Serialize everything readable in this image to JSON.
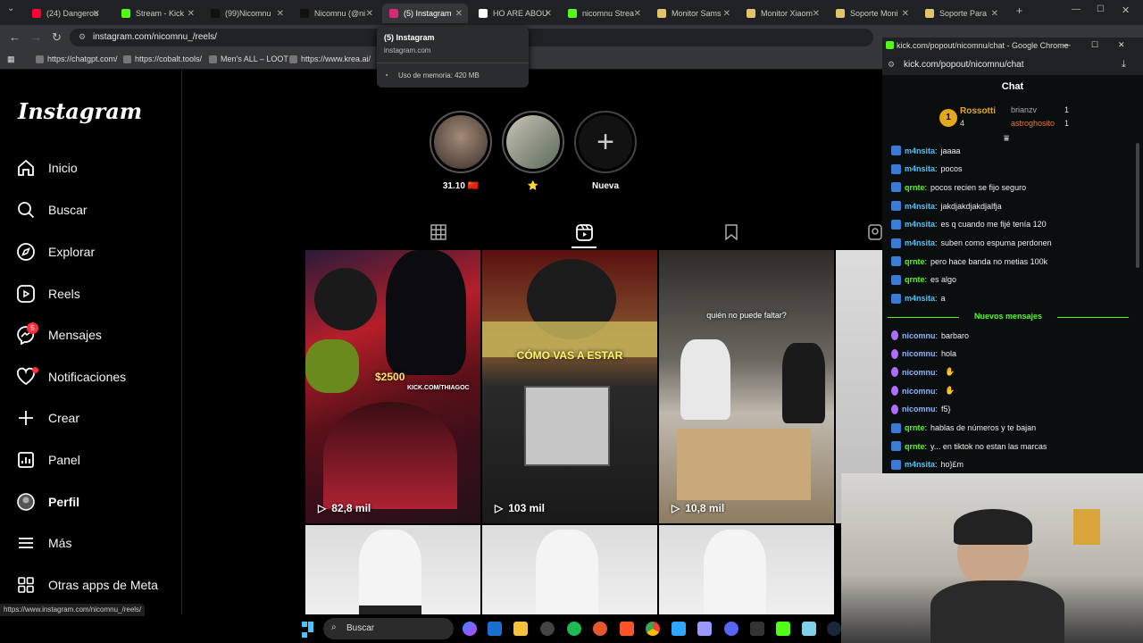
{
  "tabs": [
    {
      "label": "(24) Dangerou",
      "icon": "youtube-icon"
    },
    {
      "label": "Stream - Kick",
      "icon": "kick-icon"
    },
    {
      "label": "(99)Nicomnu",
      "icon": "tiktok-icon"
    },
    {
      "label": "Nicomnu (@ni",
      "icon": "tiktok-icon"
    },
    {
      "label": "(5) Instagram",
      "icon": "instagram-icon",
      "active": true
    },
    {
      "label": "HO ARE ABOU",
      "icon": "google-icon"
    },
    {
      "label": "nicomnu Strea",
      "icon": "kick-icon"
    },
    {
      "label": "Monitor Sams",
      "icon": "shop-icon"
    },
    {
      "label": "Monitor Xiaom",
      "icon": "shop-icon"
    },
    {
      "label": "Soporte Moni",
      "icon": "shop-icon"
    },
    {
      "label": "Soporte Para",
      "icon": "shop-icon"
    }
  ],
  "address": {
    "url": "instagram.com/nicomnu_/reels/"
  },
  "bookmarks": [
    "https://chatgpt.com/",
    "https://cobalt.tools/",
    "Men's ALL – LOOT",
    "https://www.krea.ai/"
  ],
  "tooltip": {
    "title": "(5) Instagram",
    "domain": "instagram.com",
    "memory": "Uso de memoria: 420 MB"
  },
  "sidebar": {
    "logo": "Instagram",
    "items": [
      {
        "label": "Inicio",
        "icon": "home-icon"
      },
      {
        "label": "Buscar",
        "icon": "search-icon"
      },
      {
        "label": "Explorar",
        "icon": "compass-icon"
      },
      {
        "label": "Reels",
        "icon": "reels-icon"
      },
      {
        "label": "Mensajes",
        "icon": "messenger-icon",
        "badge": "5"
      },
      {
        "label": "Notificaciones",
        "icon": "heart-icon"
      },
      {
        "label": "Crear",
        "icon": "plus-icon"
      },
      {
        "label": "Panel",
        "icon": "dashboard-icon"
      },
      {
        "label": "Perfil",
        "icon": "avatar-icon"
      },
      {
        "label": "Más",
        "icon": "menu-icon"
      },
      {
        "label": "Otras apps de Meta",
        "icon": "meta-apps-icon"
      }
    ]
  },
  "highlights": [
    {
      "label": "31.10 🇨🇳"
    },
    {
      "label": "⭐"
    },
    {
      "label": "Nueva"
    }
  ],
  "reels": [
    {
      "views": "82,8 mil",
      "overlay": "$2500",
      "overlay2": "KICK.COM/THIAGOC"
    },
    {
      "views": "103 mil",
      "overlay": "CÓMO VAS A ESTAR"
    },
    {
      "views": "10,8 mil",
      "overlay": "quién no puede faltar?"
    }
  ],
  "kick": {
    "window_title": "kick.com/popout/nicomnu/chat - Google Chrome",
    "url": "kick.com/popout/nicomnu/chat",
    "header": "Chat",
    "leaders": [
      {
        "name": "Rossotti",
        "count": "4",
        "rank": "1"
      },
      {
        "name": "brianzv",
        "count": "1"
      },
      {
        "name": "astroghosito",
        "count": "1"
      }
    ],
    "messages": [
      {
        "user": "m4nsita",
        "text": "jaaaa",
        "color": "#4fc3f7"
      },
      {
        "user": "m4nsita",
        "text": "pocos",
        "color": "#4fc3f7"
      },
      {
        "user": "qrnte",
        "text": "pocos recien se fijo seguro",
        "color": "#53fc18"
      },
      {
        "user": "m4nsita",
        "text": "jakdjakdjakdjalfja",
        "color": "#4fc3f7"
      },
      {
        "user": "m4nsita",
        "text": "es q cuando me fijé tenía 120",
        "color": "#4fc3f7"
      },
      {
        "user": "m4nsita",
        "text": "suben como espuma perdonen",
        "color": "#4fc3f7"
      },
      {
        "user": "qrnte",
        "text": "pero hace banda no metias 100k",
        "color": "#53fc18"
      },
      {
        "user": "qrnte",
        "text": "es algo",
        "color": "#53fc18"
      },
      {
        "user": "m4nsita",
        "text": "a",
        "color": "#4fc3f7"
      }
    ],
    "new_label": "Nuevos mensajes",
    "new_messages": [
      {
        "user": "nicomnu",
        "text": "barbaro",
        "color": "#8ab4ff",
        "streamer": true
      },
      {
        "user": "nicomnu",
        "text": "hola",
        "color": "#8ab4ff",
        "streamer": true
      },
      {
        "user": "nicomnu",
        "text": "",
        "color": "#8ab4ff",
        "streamer": true,
        "emote": true
      },
      {
        "user": "nicomnu",
        "text": "",
        "color": "#8ab4ff",
        "streamer": true,
        "emote": true
      },
      {
        "user": "nicomnu",
        "text": "f5}",
        "color": "#8ab4ff",
        "streamer": true
      },
      {
        "user": "qrnte",
        "text": "hablas de números y te bajan",
        "color": "#53fc18"
      },
      {
        "user": "qrnte",
        "text": "y... en tiktok no estan las marcas",
        "color": "#53fc18"
      },
      {
        "user": "m4nsita",
        "text": "ho}£m",
        "color": "#4fc3f7"
      }
    ]
  },
  "status_url": "https://www.instagram.com/nicomnu_/reels/",
  "taskbar": {
    "search_label": "Buscar"
  }
}
